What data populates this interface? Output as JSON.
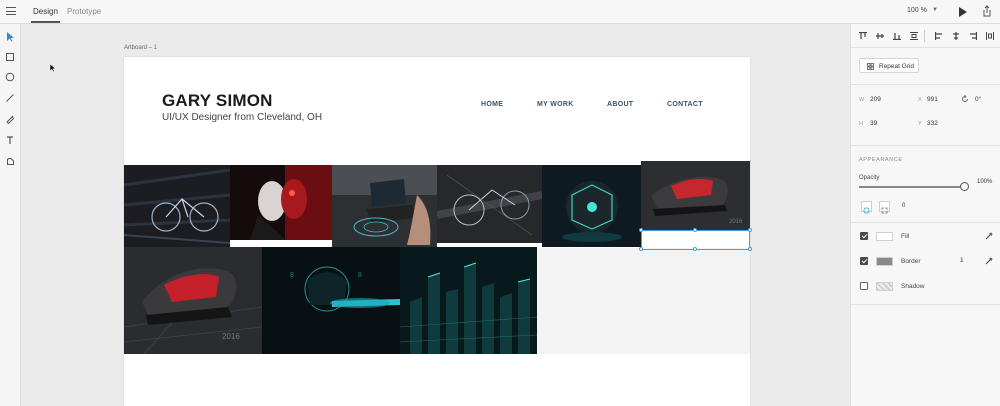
{
  "topbar": {
    "tabs": [
      {
        "label": "Design"
      },
      {
        "label": "Prototype"
      }
    ],
    "zoom": "100 %"
  },
  "canvas": {
    "artboard_label": "Artboard – 1",
    "site": {
      "name": "GARY SIMON",
      "tagline": "UI/UX Designer from Cleveland, OH",
      "nav": [
        "HOME",
        "MY WORK",
        "ABOUT",
        "CONTACT"
      ]
    }
  },
  "panel": {
    "repeat_grid": "Repeat Grid",
    "width_label": "W",
    "width_value": "209",
    "x_label": "X",
    "x_value": "991",
    "rotation_value": "0°",
    "height_label": "H",
    "height_value": "39",
    "y_label": "Y",
    "y_value": "332",
    "appearance_heading": "APPEARANCE",
    "opacity_label": "Opacity",
    "opacity_value": "100%",
    "corner_radius": "0",
    "fill_label": "Fill",
    "border_label": "Border",
    "border_width": "1",
    "shadow_label": "Shadow",
    "colors": {
      "fill": "#ffffff",
      "border": "#8a8a8a",
      "selection": "#4a9fe0",
      "nav": "#3c5266"
    }
  }
}
